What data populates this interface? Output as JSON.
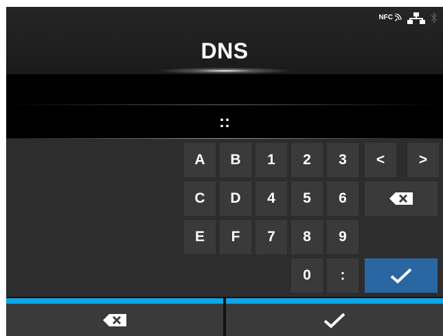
{
  "screen": {
    "title": "DNS",
    "status": {
      "nfc_label": "NFC",
      "icons": [
        "nfc-icon",
        "network-icon",
        "bluetooth-icon"
      ]
    },
    "value": "::"
  },
  "keypad": {
    "rows": [
      [
        "A",
        "B",
        "1",
        "2",
        "3"
      ],
      [
        "C",
        "D",
        "4",
        "5",
        "6"
      ],
      [
        "E",
        "F",
        "7",
        "8",
        "9"
      ],
      [
        "0",
        ":"
      ]
    ],
    "nav_left": "<",
    "nav_right": ">",
    "backspace_icon": "backspace-icon",
    "confirm_icon": "checkmark-icon"
  },
  "footer": {
    "left_icon": "backspace-icon",
    "right_icon": "checkmark-icon"
  },
  "colors": {
    "accent_bar": "#0ea8e8",
    "confirm_key": "#2a67a2",
    "key_bg": "#3a3a3a",
    "panel_bg": "#2d2d2d"
  }
}
